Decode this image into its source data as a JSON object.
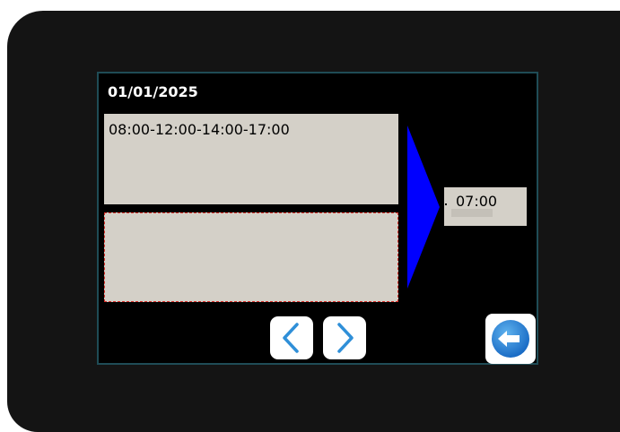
{
  "screen": {
    "date": "01/01/2025",
    "schedule": "08:00-12:00-14:00-17:00",
    "entry_value": "",
    "current_time": "07:00"
  },
  "icons": {
    "prev": "chevron-left-icon",
    "next": "chevron-right-icon",
    "back": "back-arrow-icon",
    "arrow": "arrow-right-icon"
  },
  "colors": {
    "arrow_fill": "#0000ff",
    "panel_bg": "#d4d0c8",
    "nav_chevron": "#2f8fd8",
    "back_circle": "#1f7fd6",
    "entry_border": "#d8302a"
  }
}
